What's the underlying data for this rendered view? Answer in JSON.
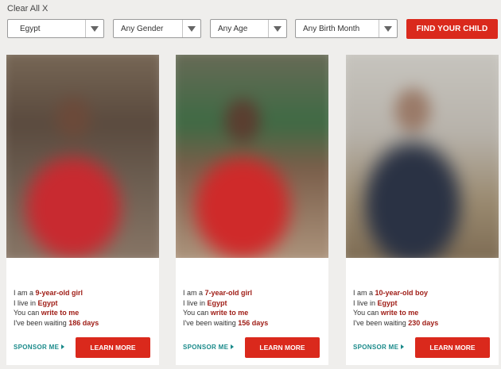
{
  "filters": {
    "clear_all": "Clear All X",
    "country": "Egypt",
    "gender": "Any Gender",
    "age": "Any Age",
    "birth_month": "Any Birth Month",
    "find_button": "FIND YOUR CHILD"
  },
  "cards": [
    {
      "line1_prefix": "I am a ",
      "age_gender": "9-year-old girl",
      "line2_prefix": "I live in ",
      "country": "Egypt",
      "line3_prefix": "You can ",
      "write": "write to me",
      "line4_prefix": "I've been waiting ",
      "waiting": "186 days",
      "sponsor": "SPONSOR ME",
      "learn": "LEARN MORE"
    },
    {
      "line1_prefix": "I am a ",
      "age_gender": "7-year-old girl",
      "line2_prefix": "I live in ",
      "country": "Egypt",
      "line3_prefix": "You can ",
      "write": "write to me",
      "line4_prefix": "I've been waiting ",
      "waiting": "156 days",
      "sponsor": "SPONSOR ME",
      "learn": "LEARN MORE"
    },
    {
      "line1_prefix": "I am a ",
      "age_gender": "10-year-old boy",
      "line2_prefix": "I live in ",
      "country": "Egypt",
      "line3_prefix": "You can ",
      "write": "write to me",
      "line4_prefix": "I've been waiting ",
      "waiting": "230 days",
      "sponsor": "SPONSOR ME",
      "learn": "LEARN MORE"
    }
  ],
  "colors": {
    "accent_red": "#da291c",
    "highlight_text": "#9e1b14",
    "sponsor_teal": "#1a8a8a",
    "background": "#efeeec"
  },
  "icons": [
    "chevron-down-icon",
    "caret-right-icon"
  ]
}
